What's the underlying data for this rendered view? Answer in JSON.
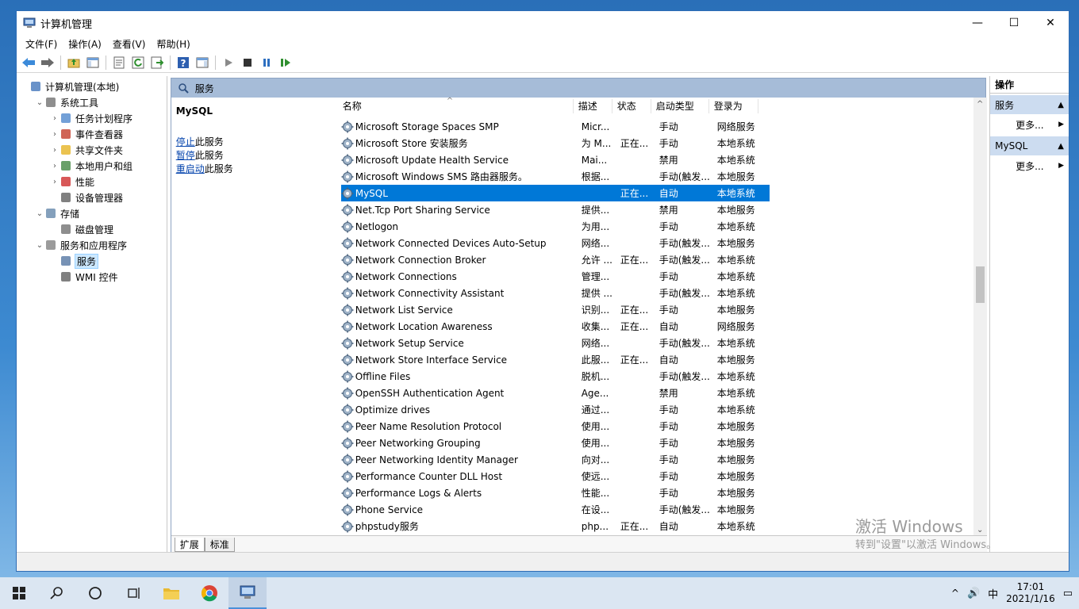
{
  "window": {
    "title": "计算机管理"
  },
  "menu": [
    "文件(F)",
    "操作(A)",
    "查看(V)",
    "帮助(H)"
  ],
  "tree": [
    {
      "label": "计算机管理(本地)",
      "level": 0,
      "arrow": "",
      "icon": "computer-management-icon"
    },
    {
      "label": "系统工具",
      "level": 1,
      "arrow": "⌄",
      "icon": "system-tools-icon"
    },
    {
      "label": "任务计划程序",
      "level": 2,
      "arrow": "›",
      "icon": "task-scheduler-icon"
    },
    {
      "label": "事件查看器",
      "level": 2,
      "arrow": "›",
      "icon": "event-viewer-icon"
    },
    {
      "label": "共享文件夹",
      "level": 2,
      "arrow": "›",
      "icon": "shared-folders-icon"
    },
    {
      "label": "本地用户和组",
      "level": 2,
      "arrow": "›",
      "icon": "local-users-icon"
    },
    {
      "label": "性能",
      "level": 2,
      "arrow": "›",
      "icon": "performance-icon"
    },
    {
      "label": "设备管理器",
      "level": 2,
      "arrow": "",
      "icon": "device-manager-icon"
    },
    {
      "label": "存储",
      "level": 1,
      "arrow": "⌄",
      "icon": "storage-icon"
    },
    {
      "label": "磁盘管理",
      "level": 2,
      "arrow": "",
      "icon": "disk-management-icon"
    },
    {
      "label": "服务和应用程序",
      "level": 1,
      "arrow": "⌄",
      "icon": "services-apps-icon"
    },
    {
      "label": "服务",
      "level": 2,
      "arrow": "",
      "icon": "services-icon",
      "selected": true
    },
    {
      "label": "WMI 控件",
      "level": 2,
      "arrow": "",
      "icon": "wmi-icon"
    }
  ],
  "center": {
    "header": "服务",
    "selected_service": "MySQL",
    "actions": [
      {
        "link": "停止",
        "rest": "此服务"
      },
      {
        "link": "暂停",
        "rest": "此服务"
      },
      {
        "link": "重启动",
        "rest": "此服务"
      }
    ],
    "columns": [
      "名称",
      "描述",
      "状态",
      "启动类型",
      "登录为"
    ],
    "rows": [
      [
        "Microsoft Storage Spaces SMP",
        "Micr...",
        "",
        "手动",
        "网络服务"
      ],
      [
        "Microsoft Store 安装服务",
        "为 M...",
        "正在...",
        "手动",
        "本地系统"
      ],
      [
        "Microsoft Update Health Service",
        "Mai...",
        "",
        "禁用",
        "本地系统"
      ],
      [
        "Microsoft Windows SMS 路由器服务。",
        "根据...",
        "",
        "手动(触发...",
        "本地服务"
      ],
      [
        "MySQL",
        "",
        "正在...",
        "自动",
        "本地系统"
      ],
      [
        "Net.Tcp Port Sharing Service",
        "提供...",
        "",
        "禁用",
        "本地服务"
      ],
      [
        "Netlogon",
        "为用...",
        "",
        "手动",
        "本地系统"
      ],
      [
        "Network Connected Devices Auto-Setup",
        "网络...",
        "",
        "手动(触发...",
        "本地服务"
      ],
      [
        "Network Connection Broker",
        "允许 ...",
        "正在...",
        "手动(触发...",
        "本地系统"
      ],
      [
        "Network Connections",
        "管理...",
        "",
        "手动",
        "本地系统"
      ],
      [
        "Network Connectivity Assistant",
        "提供 ...",
        "",
        "手动(触发...",
        "本地系统"
      ],
      [
        "Network List Service",
        "识别...",
        "正在...",
        "手动",
        "本地服务"
      ],
      [
        "Network Location Awareness",
        "收集...",
        "正在...",
        "自动",
        "网络服务"
      ],
      [
        "Network Setup Service",
        "网络...",
        "",
        "手动(触发...",
        "本地系统"
      ],
      [
        "Network Store Interface Service",
        "此服...",
        "正在...",
        "自动",
        "本地服务"
      ],
      [
        "Offline Files",
        "脱机...",
        "",
        "手动(触发...",
        "本地系统"
      ],
      [
        "OpenSSH Authentication Agent",
        "Age...",
        "",
        "禁用",
        "本地系统"
      ],
      [
        "Optimize drives",
        "通过...",
        "",
        "手动",
        "本地系统"
      ],
      [
        "Peer Name Resolution Protocol",
        "使用...",
        "",
        "手动",
        "本地服务"
      ],
      [
        "Peer Networking Grouping",
        "使用...",
        "",
        "手动",
        "本地服务"
      ],
      [
        "Peer Networking Identity Manager",
        "向对...",
        "",
        "手动",
        "本地服务"
      ],
      [
        "Performance Counter DLL Host",
        "使远...",
        "",
        "手动",
        "本地服务"
      ],
      [
        "Performance Logs & Alerts",
        "性能...",
        "",
        "手动",
        "本地服务"
      ],
      [
        "Phone Service",
        "在设...",
        "",
        "手动(触发...",
        "本地服务"
      ],
      [
        "phpstudy服务",
        "php...",
        "正在...",
        "自动",
        "本地系统"
      ]
    ],
    "selected_row": 4,
    "tabs": [
      "扩展",
      "标准"
    ]
  },
  "actions_pane": {
    "title": "操作",
    "sections": [
      {
        "label": "服务",
        "more": "更多..."
      },
      {
        "label": "MySQL",
        "more": "更多..."
      }
    ]
  },
  "watermark": {
    "line1": "激活 Windows",
    "line2": "转到\"设置\"以激活 Windows。"
  },
  "taskbar": {
    "time": "17:01",
    "date": "2021/1/16",
    "ime": "中"
  },
  "colors": {
    "selection": "#0078d7",
    "header": "#a6bcd8",
    "section": "#ccdcf0"
  }
}
